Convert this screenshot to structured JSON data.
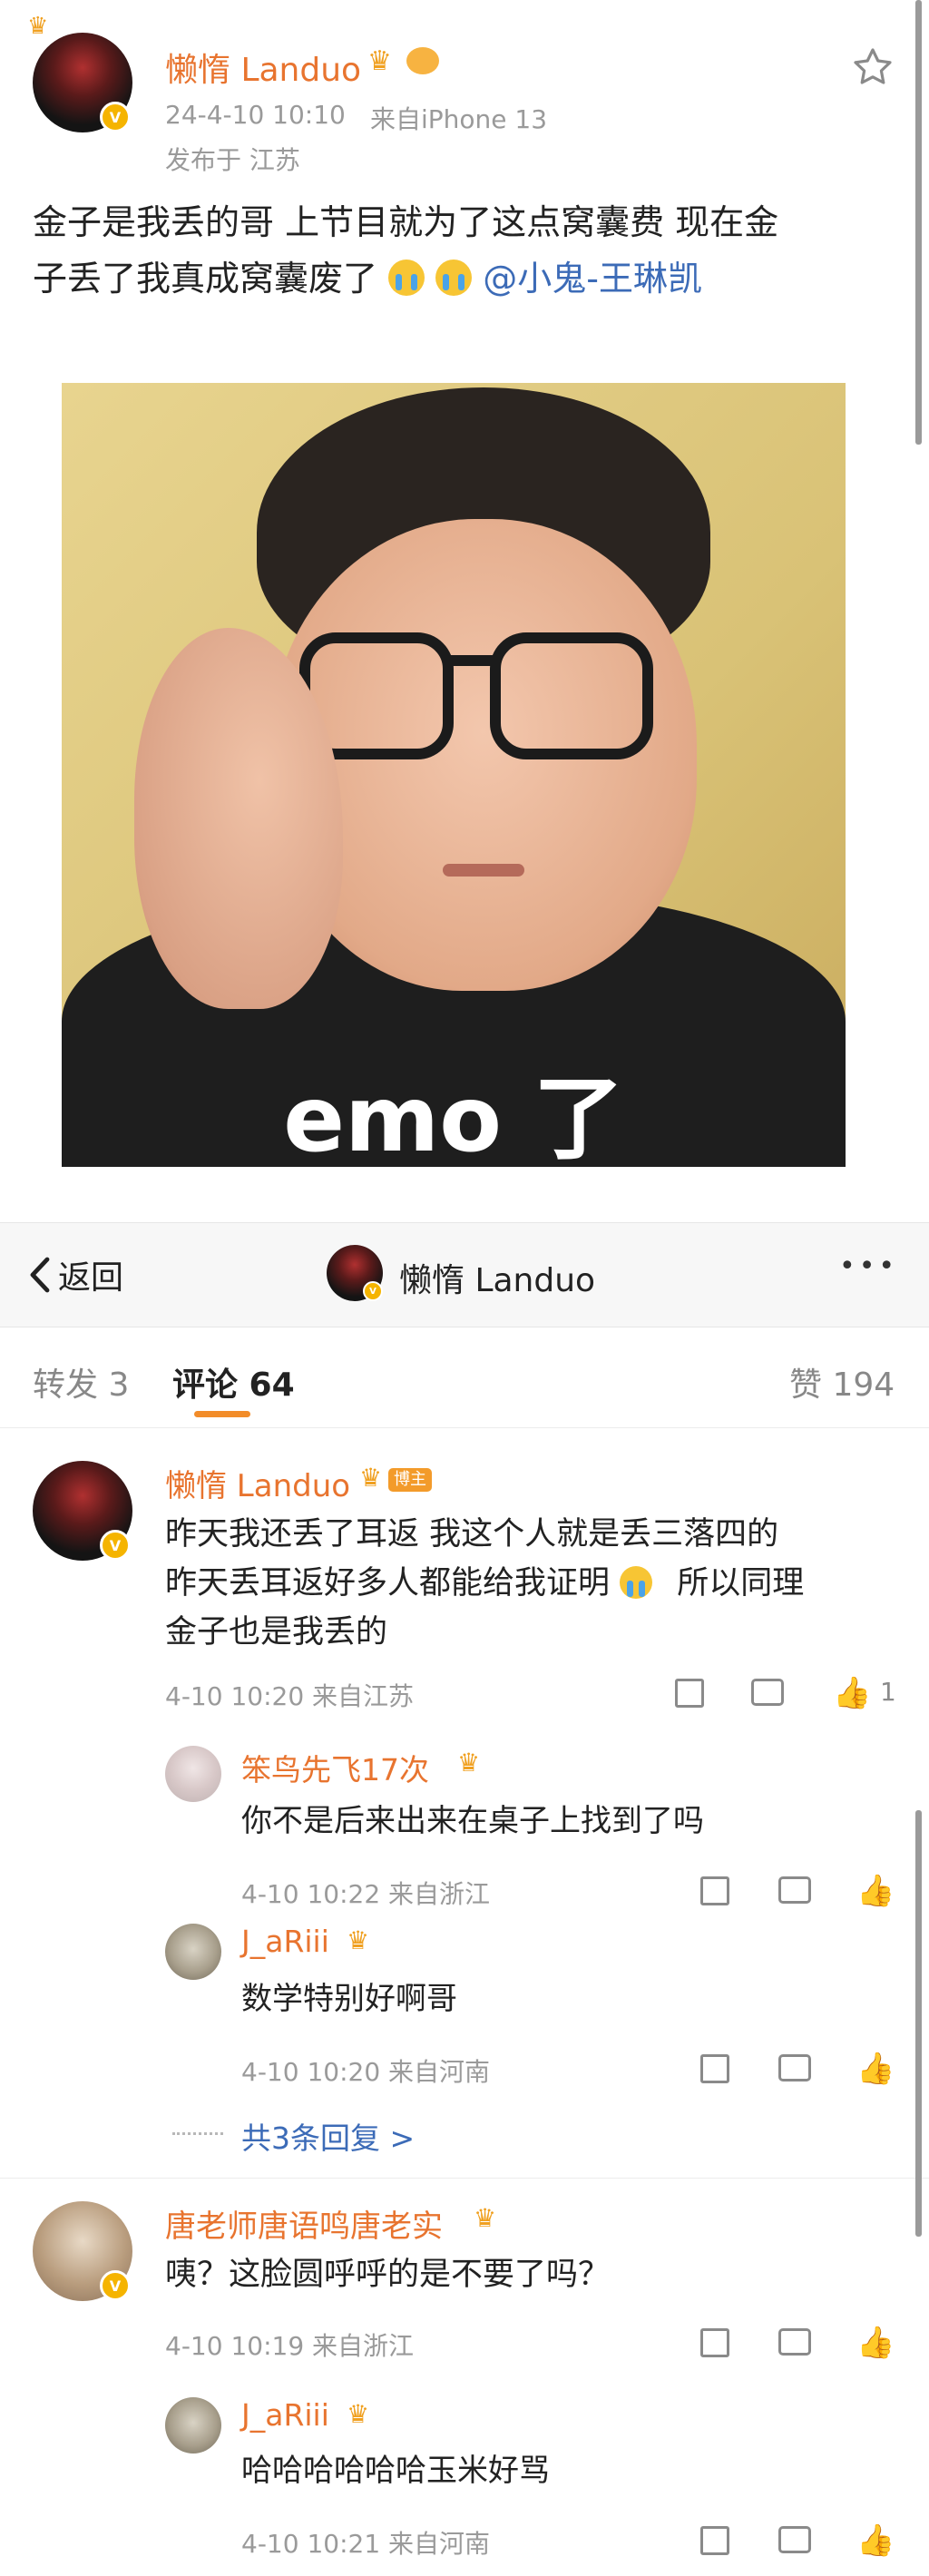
{
  "post": {
    "author": "懒惰 Landuo",
    "timestamp": "24-4-10 10:10",
    "source": "来自iPhone 13",
    "location": "发布于 江苏",
    "text_line1": "金子是我丢的哥 上节目就为了这点窝囊费 现在金",
    "text_line2": "子丢了我真成窝囊废了",
    "mention": "@小鬼-王琳凯",
    "image_caption": "emo 了"
  },
  "nav": {
    "back_label": "返回",
    "title": "懒惰 Landuo",
    "more": "•••"
  },
  "tabs": {
    "repost": "转发 3",
    "comments": "评论 64",
    "likes": "赞 194"
  },
  "comments": [
    {
      "author": "懒惰 Landuo",
      "tag": "博主",
      "line1": "昨天我还丢了耳返 我这个人就是丢三落四的",
      "line2": "昨天丢耳返好多人都能给我证明",
      "line2b": "所以同理",
      "line3": "金子也是我丢的",
      "meta": "4-10 10:20 来自江苏",
      "like_count": "1",
      "replies": [
        {
          "author": "笨鸟先飞17次",
          "text": "你不是后来出来在桌子上找到了吗",
          "meta": "4-10 10:22 来自浙江"
        },
        {
          "author": "J_aRiii",
          "text": "数学特别好啊哥",
          "meta": "4-10 10:20 来自河南"
        }
      ],
      "more_replies": "共3条回复 >"
    },
    {
      "author": "唐老师唐语鸣唐老实",
      "text": "咦？这脸圆呼呼的是不要了吗？",
      "meta": "4-10 10:19 来自浙江",
      "replies": [
        {
          "author": "J_aRiii",
          "text": "哈哈哈哈哈哈玉米好骂",
          "meta": "4-10 10:21 来自河南"
        }
      ]
    }
  ],
  "colors": {
    "name": "#e8742f",
    "mention": "#3c6bb7",
    "badge": "#f5b400"
  }
}
